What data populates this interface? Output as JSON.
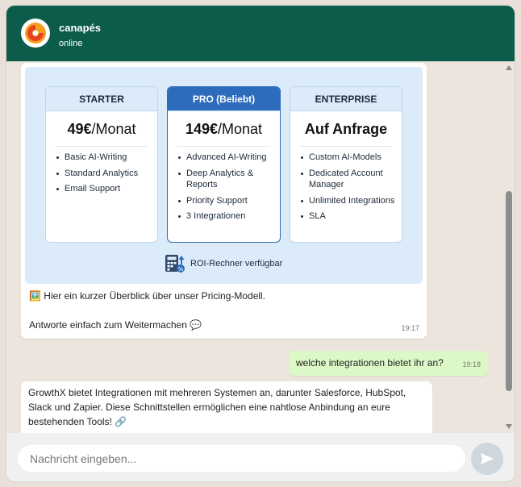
{
  "header": {
    "name": "canapés",
    "status": "online",
    "avatar_icon": "orange-swirl-logo"
  },
  "pricing": {
    "plans": [
      {
        "name": "STARTER",
        "price_bold": "49€",
        "price_rest": "/Monat",
        "features": [
          "Basic AI-Writing",
          "Standard Analytics",
          "Email Support"
        ]
      },
      {
        "name": "PRO (Beliebt)",
        "price_bold": "149€",
        "price_rest": "/Monat",
        "features": [
          "Advanced AI-Writing",
          "Deep Analytics & Reports",
          "Priority Support",
          "3 Integrationen"
        ]
      },
      {
        "name": "ENTERPRISE",
        "price_bold": "Auf Anfrage",
        "price_rest": "",
        "features": [
          "Custom AI-Models",
          "Dedicated Account Manager",
          "Unlimited Integrations",
          "SLA"
        ]
      }
    ],
    "roi_text": "ROI-Rechner verfügbar",
    "roi_icon": "calculator-icon"
  },
  "messages": {
    "m1_line1": "🖼️ Hier ein kurzer Überblick über unser Pricing-Modell.",
    "m1_line2": "Antworte einfach zum Weitermachen 💬",
    "m1_time": "19:17",
    "m2_text": "welche integrationen bietet ihr an?",
    "m2_time": "19:18",
    "m3_text": "GrowthX bietet Integrationen mit mehreren Systemen an, darunter Salesforce, HubSpot, Slack und Zapier. Diese Schnittstellen ermöglichen eine nahtlose Anbindung an eure bestehenden Tools! 🔗"
  },
  "composer": {
    "placeholder": "Nachricht eingeben...",
    "send_icon": "send-arrow-icon"
  },
  "colors": {
    "header": "#0b5c4b",
    "outgoing": "#dcf8c6",
    "pro_accent": "#2d6bbd"
  }
}
